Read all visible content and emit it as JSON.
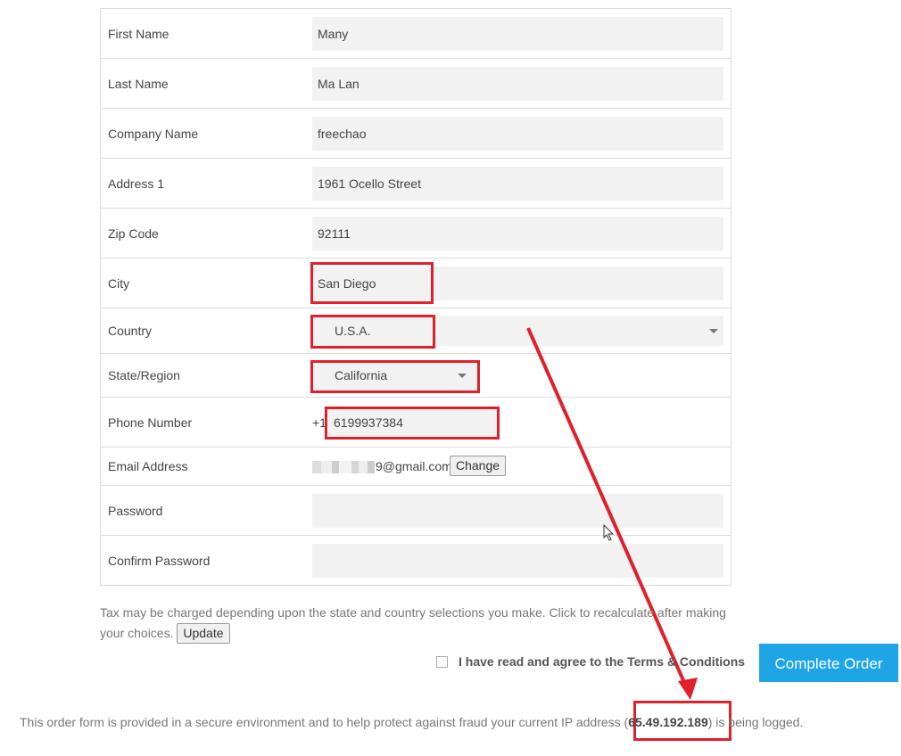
{
  "form": {
    "first_name_label": "First Name",
    "first_name_value": "Many",
    "last_name_label": "Last Name",
    "last_name_value": "Ma Lan",
    "company_label": "Company Name",
    "company_value": "freechao",
    "address_label": "Address 1",
    "address_value": "1961  Ocello Street",
    "zip_label": "Zip Code",
    "zip_value": "92111",
    "city_label": "City",
    "city_value": "San Diego",
    "country_label": "Country",
    "country_value": "U.S.A.",
    "state_label": "State/Region",
    "state_value": "California",
    "phone_label": "Phone Number",
    "phone_prefix": "+1",
    "phone_value": "6199937384",
    "email_label": "Email Address",
    "email_value": "9@gmail.com",
    "change_button": "Change",
    "password_label": "Password",
    "password_value": "",
    "confirm_password_label": "Confirm Password",
    "confirm_password_value": ""
  },
  "tax_note": {
    "text": "Tax may be charged depending upon the state and country selections you make. Click to recalculate after making your choices.",
    "update_button": "Update"
  },
  "agree": {
    "prefix": "I have read and agree to the ",
    "link": "Terms & Conditions"
  },
  "complete_button": "Complete Order",
  "footer": {
    "before": "This order form is provided in a secure environment and to help protect against fraud your current IP address (",
    "ip": "65.49.192.189",
    "after": ") is being logged."
  },
  "colors": {
    "annotation_red": "#e0202a",
    "primary_button": "#1ea5e5",
    "field_background": "#f2f2f2"
  }
}
